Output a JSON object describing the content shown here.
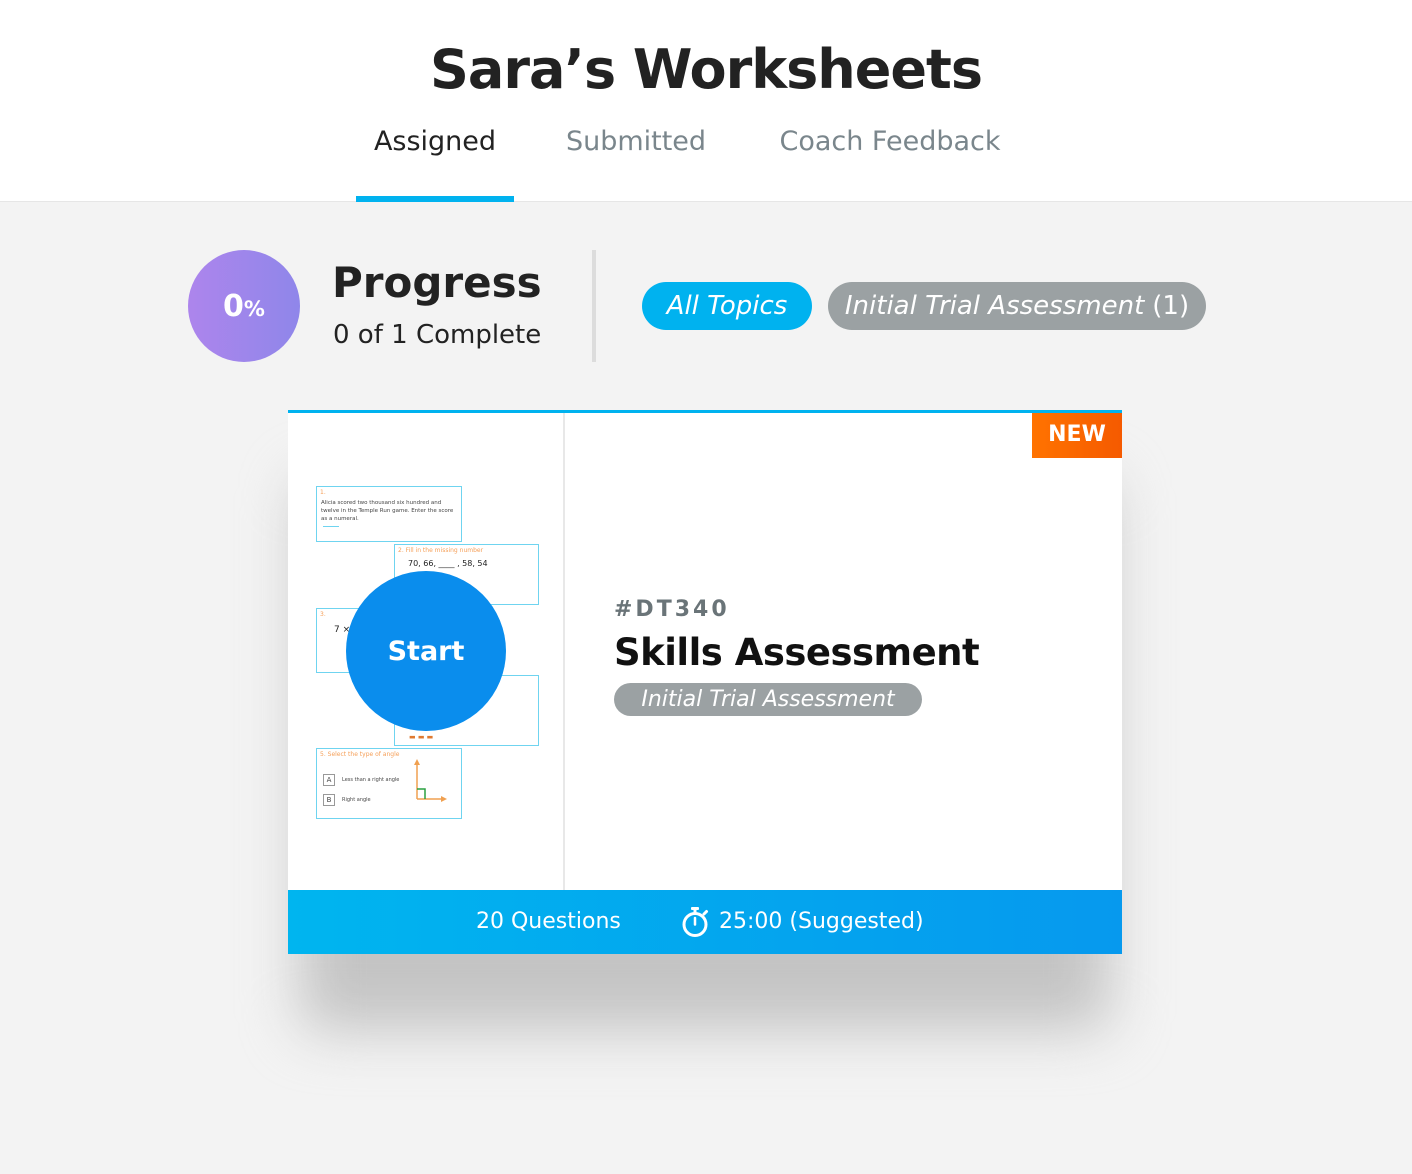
{
  "header": {
    "title": "Sara’s Worksheets",
    "tabs": [
      {
        "label": "Assigned",
        "active": true
      },
      {
        "label": "Submitted",
        "active": false
      },
      {
        "label": "Coach Feedback",
        "active": false
      }
    ]
  },
  "progress": {
    "percent_value": "0",
    "percent_sign": "%",
    "title": "Progress",
    "summary": "0 of 1 Complete"
  },
  "filters": {
    "all_topics": "All Topics",
    "topic_label": "Initial Trial Assessment",
    "topic_count": "(1)"
  },
  "colors": {
    "accent": "#00b2ef",
    "start_button": "#0a8ded",
    "new_badge": "#f96800",
    "chip_gray": "#9ba1a3",
    "progress_purple": "#9e86eb"
  },
  "card": {
    "badge": "NEW",
    "start_label": "Start",
    "code": "#DT340",
    "title": "Skills Assessment",
    "tag": "Initial Trial Assessment",
    "questions": "20 Questions",
    "timer_icon": "stopwatch-icon",
    "time": "25:00 (Suggested)",
    "thumbnail": {
      "q1_num": "1.",
      "q1_text": "Alicia scored two thousand six hundred and twelve in the Temple Run game. Enter the score as a numeral.",
      "q2_label": "2. Fill in the missing number",
      "q2_sequence": "70, 66, ____ , 58, 54",
      "q3_num": "3.",
      "q3_text": "7 ×",
      "q5_label": "5. Select the type of angle",
      "q5_option_a_letter": "A",
      "q5_option_a": "Less than a right angle",
      "q5_option_b_letter": "B",
      "q5_option_b": "Right angle"
    }
  }
}
